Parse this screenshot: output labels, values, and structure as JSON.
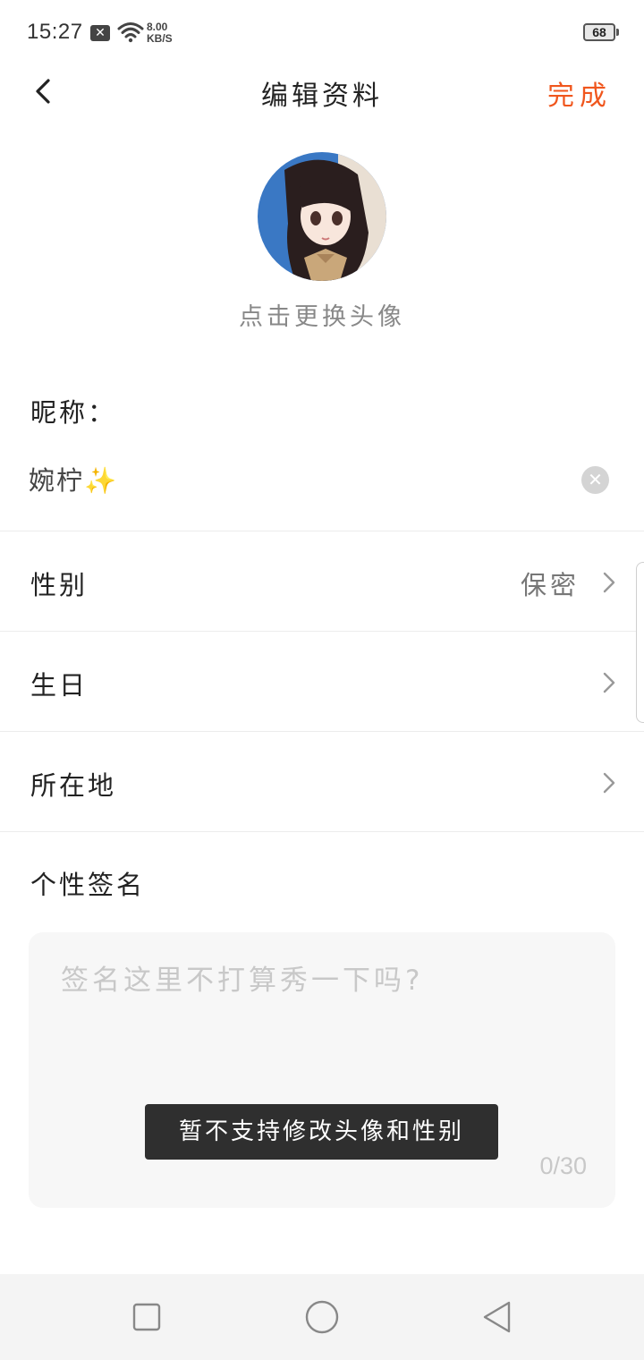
{
  "status_bar": {
    "time": "15:27",
    "notification_icon": "close-box-icon",
    "wifi_icon": "wifi-icon",
    "speed_value": "8.00",
    "speed_unit": "KB/S",
    "battery_level": "68"
  },
  "header": {
    "back_icon": "chevron-left-icon",
    "title": "编辑资料",
    "done_label": "完成",
    "done_color": "#f0561d"
  },
  "avatar": {
    "hint": "点击更换头像"
  },
  "nickname": {
    "label": "昵称：",
    "value": "婉柠✨",
    "clear_icon": "clear-circle-icon"
  },
  "rows": [
    {
      "label": "性别",
      "value": "保密"
    },
    {
      "label": "生日",
      "value": ""
    },
    {
      "label": "所在地",
      "value": ""
    }
  ],
  "signature": {
    "label": "个性签名",
    "placeholder": "签名这里不打算秀一下吗?",
    "counter": "0/30"
  },
  "toast": {
    "message": "暂不支持修改头像和性别"
  },
  "nav_bar": {
    "recents_icon": "square-icon",
    "home_icon": "circle-icon",
    "back_icon": "triangle-back-icon"
  }
}
